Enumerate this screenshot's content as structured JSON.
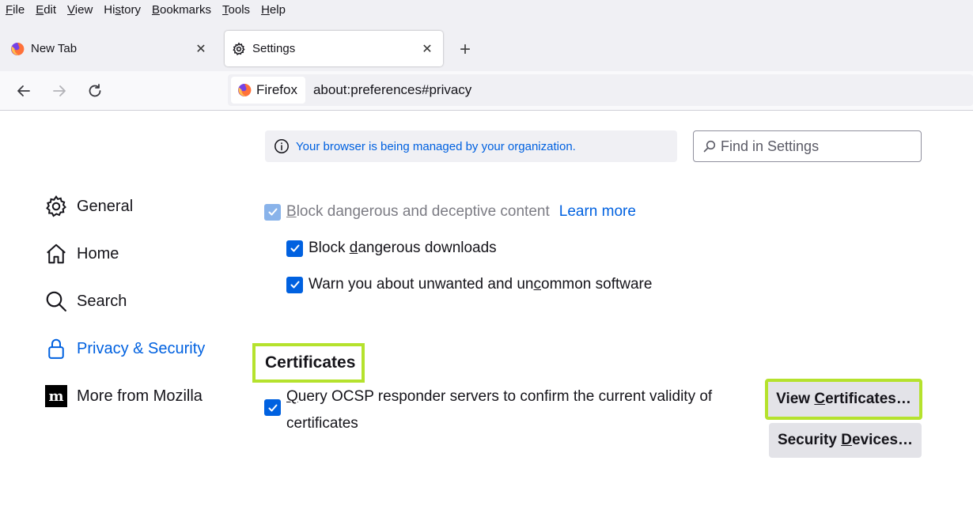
{
  "menubar": {
    "items": [
      {
        "pre": "",
        "key": "F",
        "post": "ile"
      },
      {
        "pre": "",
        "key": "E",
        "post": "dit"
      },
      {
        "pre": "",
        "key": "V",
        "post": "iew"
      },
      {
        "pre": "Hi",
        "key": "s",
        "post": "tory"
      },
      {
        "pre": "",
        "key": "B",
        "post": "ookmarks"
      },
      {
        "pre": "",
        "key": "T",
        "post": "ools"
      },
      {
        "pre": "",
        "key": "H",
        "post": "elp"
      }
    ]
  },
  "tabs": [
    {
      "label": "New Tab",
      "icon": "firefox-icon",
      "active": false
    },
    {
      "label": "Settings",
      "icon": "gear-icon",
      "active": true
    }
  ],
  "tab_close_glyph": "✕",
  "new_tab_glyph": "+",
  "navbar": {
    "identity_label": "Firefox",
    "url": "about:preferences#privacy"
  },
  "policy": {
    "text": "Your browser is being managed by your organization."
  },
  "search": {
    "placeholder": "Find in Settings"
  },
  "sidebar": {
    "items": [
      {
        "label": "General",
        "icon": "gear-icon",
        "selected": false
      },
      {
        "label": "Home",
        "icon": "home-icon",
        "selected": false
      },
      {
        "label": "Search",
        "icon": "search-icon",
        "selected": false
      },
      {
        "label": "Privacy & Security",
        "icon": "lock-icon",
        "selected": true
      },
      {
        "label": "More from Mozilla",
        "icon": "mozilla-icon",
        "selected": false
      }
    ]
  },
  "deceptive": {
    "block_pre": "",
    "block_key": "B",
    "block_post": "lock dangerous and deceptive content",
    "learn_more": "Learn more",
    "downloads_pre": "Block ",
    "downloads_key": "d",
    "downloads_post": "angerous downloads",
    "warn_pre": "Warn you about unwanted and un",
    "warn_key": "c",
    "warn_post": "ommon software",
    "block_checked": true,
    "downloads_checked": true,
    "warn_checked": true
  },
  "certificates": {
    "heading": "Certificates",
    "ocsp_key": "Q",
    "ocsp_post": "uery OCSP responder servers to confirm the current validity of certificates",
    "ocsp_checked": true,
    "view_pre": "View ",
    "view_key": "C",
    "view_post": "ertificates…",
    "security_pre": "Security ",
    "security_key": "D",
    "security_post": "evices…"
  },
  "colors": {
    "accent": "#0061e0",
    "highlight": "#b5e22d",
    "chrome": "#f0f0f4"
  }
}
